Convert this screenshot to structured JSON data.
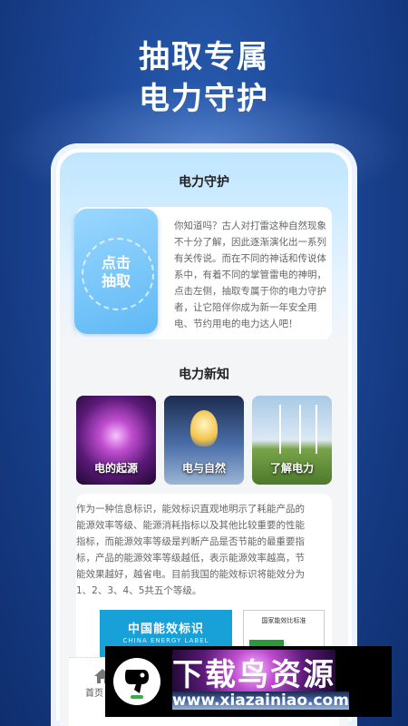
{
  "headline": {
    "line1": "抽取专属",
    "line2": "电力守护"
  },
  "guard": {
    "title": "电力守护",
    "ticket_label_1": "点击",
    "ticket_label_2": "抽取",
    "text": "你知道吗？古人对打雷这种自然现象不十分了解，因此逐渐演化出一系列有关传说。而在不同的神话和传说体系中，有着不同的掌管雷电的神明，点击左侧，抽取专属于你的电力守护者，让它陪伴你成为新一年安全用电、节约用电的电力达人吧！"
  },
  "news": {
    "title": "电力新知",
    "tiles": [
      {
        "label": "电的起源"
      },
      {
        "label": "电与自然"
      },
      {
        "label": "了解电力"
      }
    ]
  },
  "info": {
    "text": "作为一种信息标识，能效标识直观地明示了耗能产品的能源效率等级、能源消耗指标以及其他比较重要的性能指标，而能源效率等级是判断产品是否节能的最重要指标，产品的能源效率等级越低，表示能源效率越高，节能效果越好，越省电。目前我国的能效标识将能效分为1、2、3、4、5共五个等级。",
    "label_cn": "中国能效标识",
    "label_en": "CHINA ENERGY LABEL",
    "label2_title": "国家能效比标准"
  },
  "tabbar": {
    "home_label": "首页"
  },
  "watermark": {
    "title": "下载鸟资源",
    "url": "www.xiazainiao.com"
  }
}
